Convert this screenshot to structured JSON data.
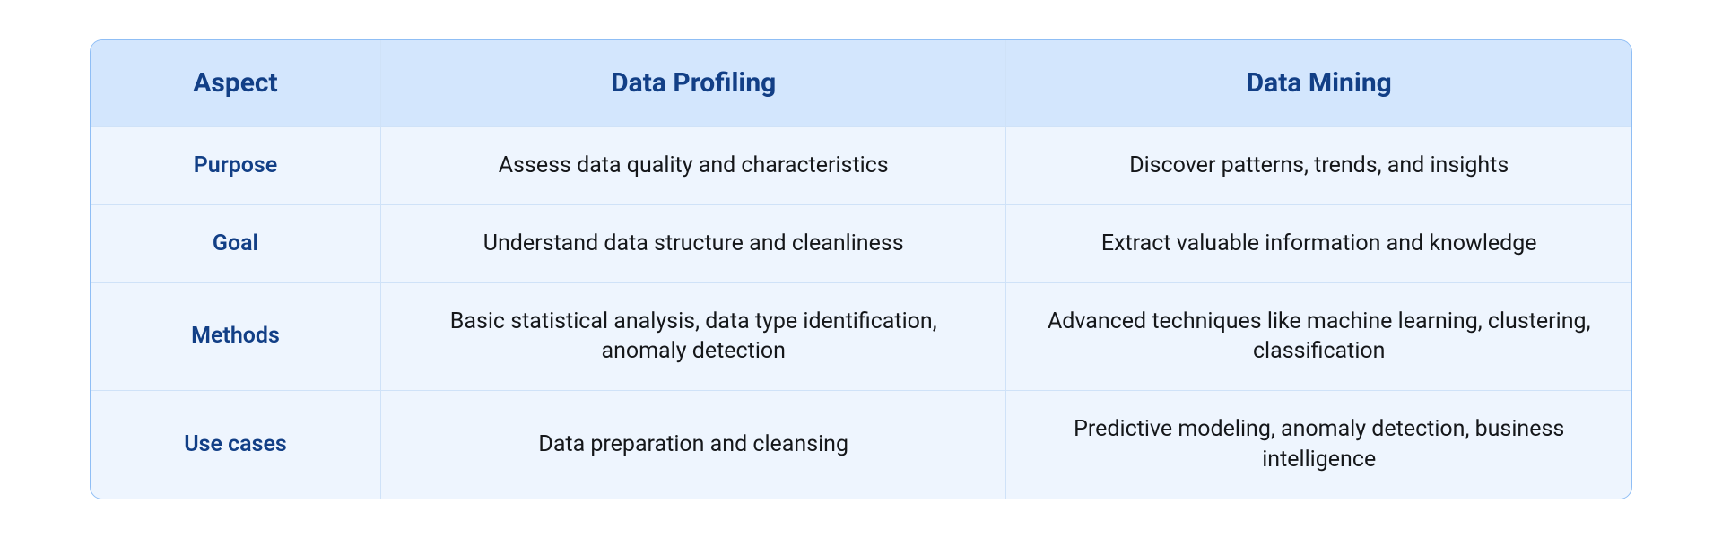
{
  "table": {
    "headers": {
      "aspect": "Aspect",
      "profiling": "Data Profiling",
      "mining": "Data Mining"
    },
    "rows": [
      {
        "aspect": "Purpose",
        "profiling": "Assess data quality and characteristics",
        "mining": "Discover patterns, trends, and insights"
      },
      {
        "aspect": "Goal",
        "profiling": "Understand data structure and cleanliness",
        "mining": "Extract valuable information and knowledge"
      },
      {
        "aspect": "Methods",
        "profiling": "Basic statistical analysis, data type identification, anomaly detection",
        "mining": "Advanced techniques like machine learning, clustering, classification"
      },
      {
        "aspect": "Use cases",
        "profiling": "Data preparation and cleansing",
        "mining": "Predictive modeling, anomaly detection, business intelligence"
      }
    ]
  }
}
